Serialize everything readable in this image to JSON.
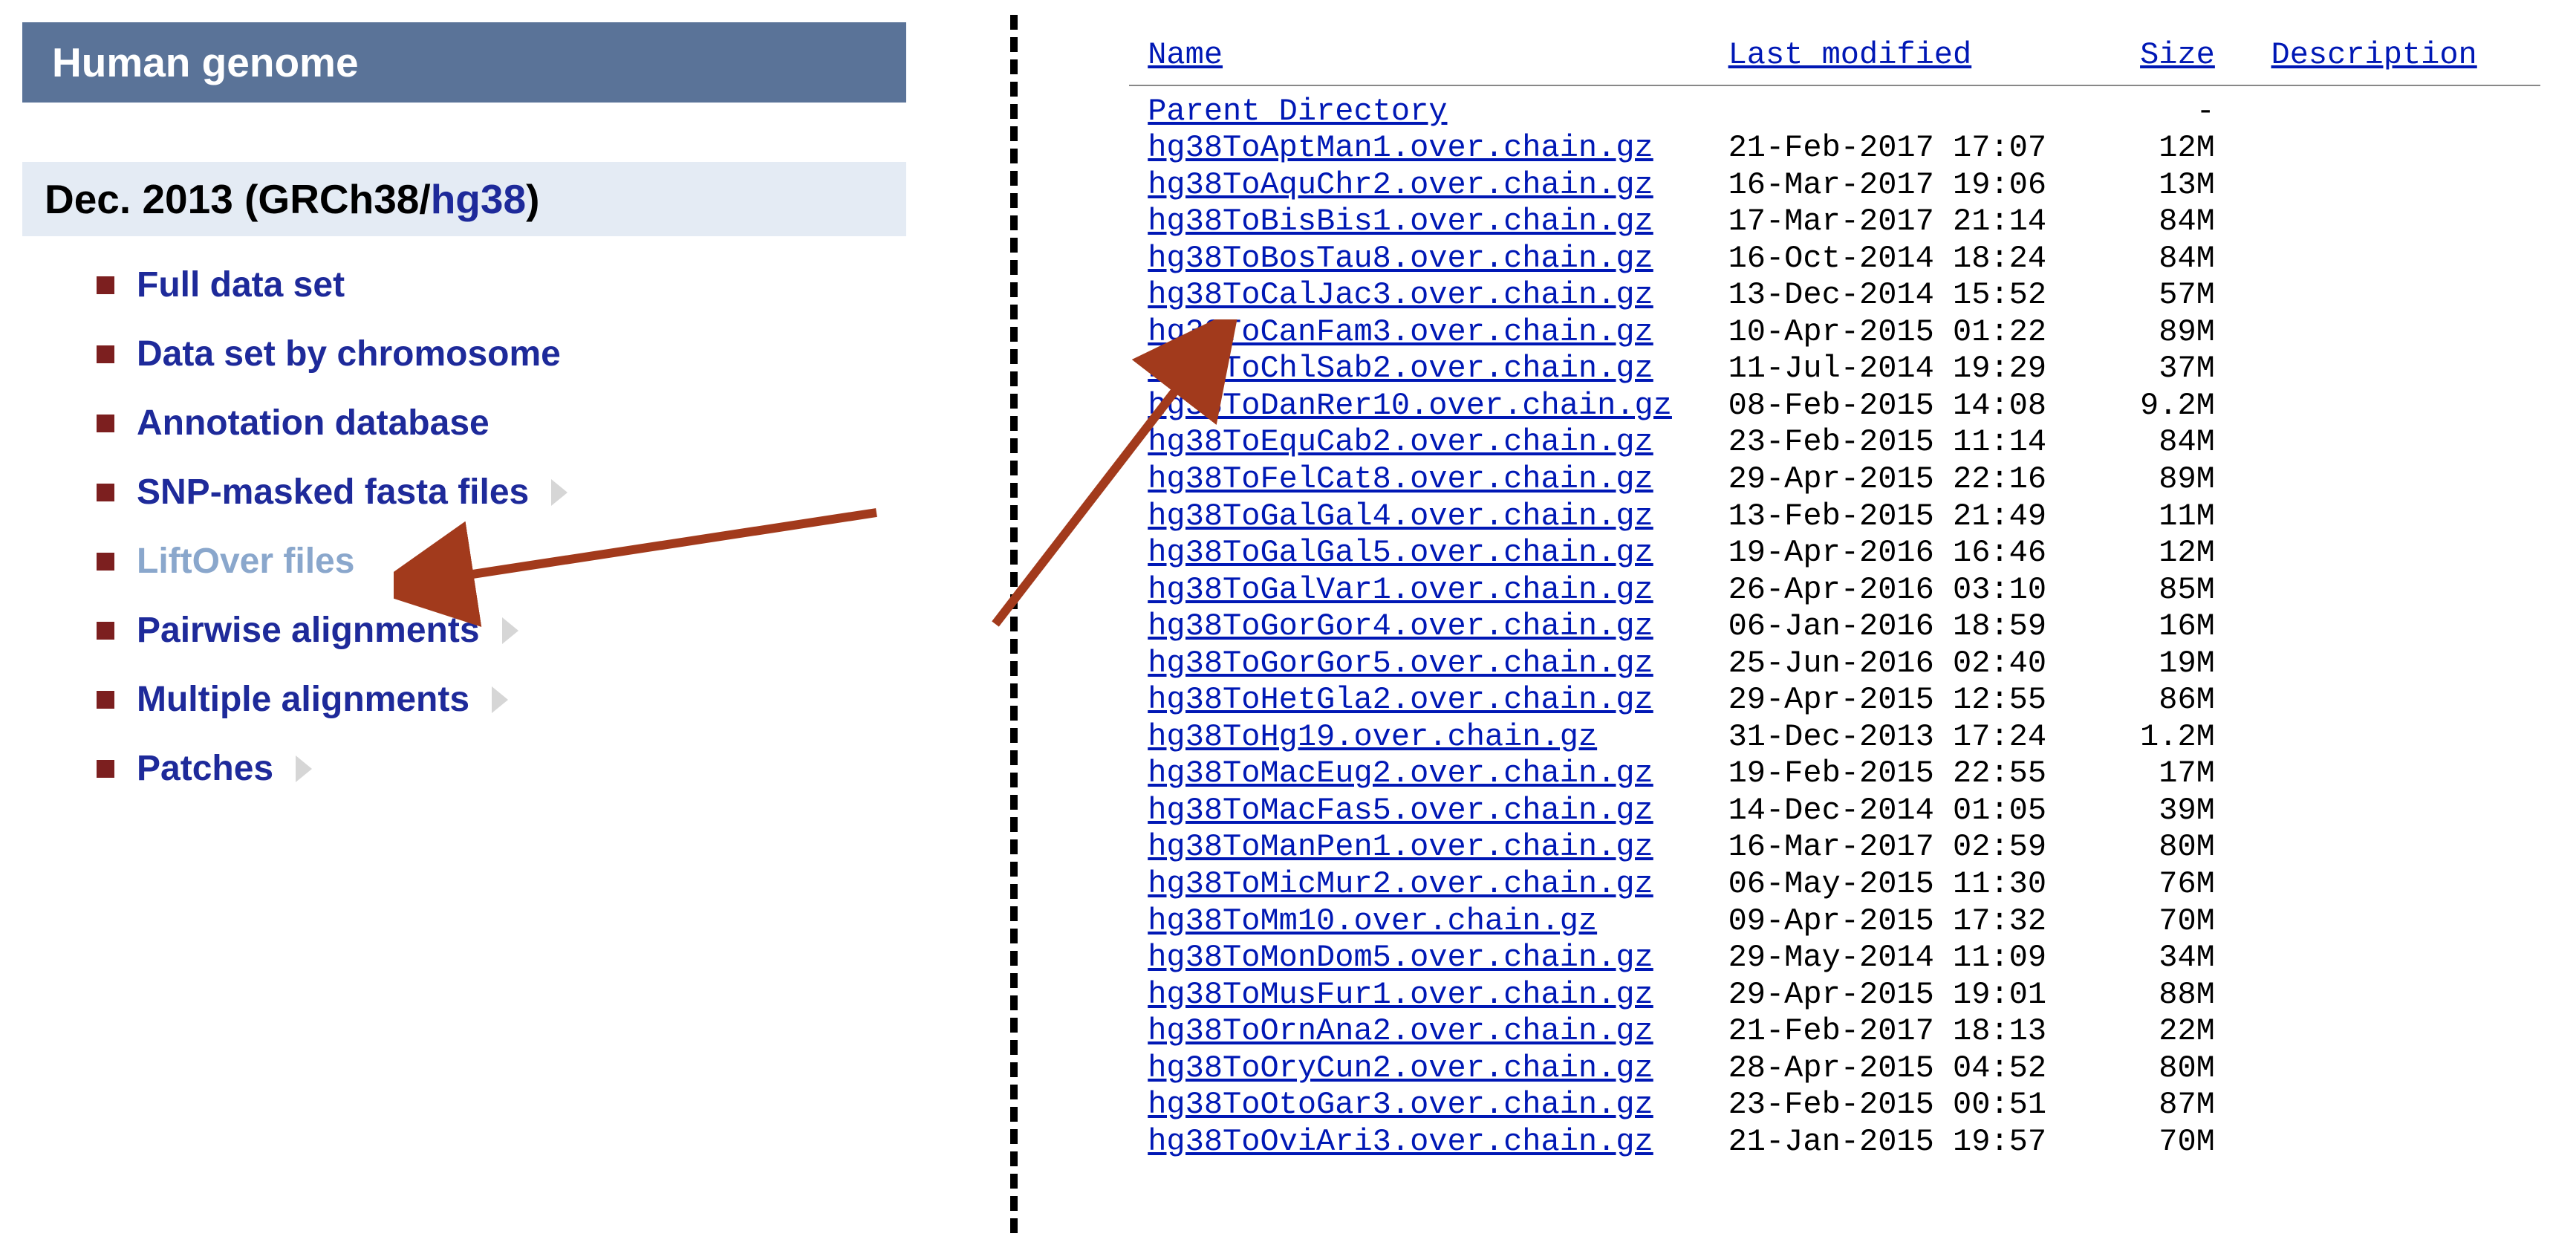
{
  "sidebar": {
    "header": "Human genome",
    "subheader_prefix": "Dec. 2013 (GRCh38/",
    "subheader_link": "hg38",
    "subheader_suffix": ")",
    "items": [
      {
        "label": "Full data set",
        "chevron": false,
        "active": false
      },
      {
        "label": "Data set by chromosome",
        "chevron": false,
        "active": false
      },
      {
        "label": "Annotation database",
        "chevron": false,
        "active": false
      },
      {
        "label": "SNP-masked fasta files",
        "chevron": true,
        "active": false
      },
      {
        "label": "LiftOver files",
        "chevron": false,
        "active": true
      },
      {
        "label": "Pairwise alignments",
        "chevron": true,
        "active": false
      },
      {
        "label": "Multiple alignments",
        "chevron": true,
        "active": false
      },
      {
        "label": "Patches",
        "chevron": true,
        "active": false
      }
    ]
  },
  "listing": {
    "cols": {
      "name": "Name",
      "modified": "Last modified",
      "size": "Size",
      "desc": "Description"
    },
    "parent": "Parent Directory",
    "rows": [
      {
        "name": "hg38ToAptMan1.over.chain.gz",
        "modified": "21-Feb-2017 17:07",
        "size": "12M"
      },
      {
        "name": "hg38ToAquChr2.over.chain.gz",
        "modified": "16-Mar-2017 19:06",
        "size": "13M"
      },
      {
        "name": "hg38ToBisBis1.over.chain.gz",
        "modified": "17-Mar-2017 21:14",
        "size": "84M"
      },
      {
        "name": "hg38ToBosTau8.over.chain.gz",
        "modified": "16-Oct-2014 18:24",
        "size": "84M"
      },
      {
        "name": "hg38ToCalJac3.over.chain.gz",
        "modified": "13-Dec-2014 15:52",
        "size": "57M"
      },
      {
        "name": "hg38ToCanFam3.over.chain.gz",
        "modified": "10-Apr-2015 01:22",
        "size": "89M"
      },
      {
        "name": "hg38ToChlSab2.over.chain.gz",
        "modified": "11-Jul-2014 19:29",
        "size": "37M"
      },
      {
        "name": "hg38ToDanRer10.over.chain.gz",
        "modified": "08-Feb-2015 14:08",
        "size": "9.2M"
      },
      {
        "name": "hg38ToEquCab2.over.chain.gz",
        "modified": "23-Feb-2015 11:14",
        "size": "84M"
      },
      {
        "name": "hg38ToFelCat8.over.chain.gz",
        "modified": "29-Apr-2015 22:16",
        "size": "89M"
      },
      {
        "name": "hg38ToGalGal4.over.chain.gz",
        "modified": "13-Feb-2015 21:49",
        "size": "11M"
      },
      {
        "name": "hg38ToGalGal5.over.chain.gz",
        "modified": "19-Apr-2016 16:46",
        "size": "12M"
      },
      {
        "name": "hg38ToGalVar1.over.chain.gz",
        "modified": "26-Apr-2016 03:10",
        "size": "85M"
      },
      {
        "name": "hg38ToGorGor4.over.chain.gz",
        "modified": "06-Jan-2016 18:59",
        "size": "16M"
      },
      {
        "name": "hg38ToGorGor5.over.chain.gz",
        "modified": "25-Jun-2016 02:40",
        "size": "19M"
      },
      {
        "name": "hg38ToHetGla2.over.chain.gz",
        "modified": "29-Apr-2015 12:55",
        "size": "86M"
      },
      {
        "name": "hg38ToHg19.over.chain.gz",
        "modified": "31-Dec-2013 17:24",
        "size": "1.2M"
      },
      {
        "name": "hg38ToMacEug2.over.chain.gz",
        "modified": "19-Feb-2015 22:55",
        "size": "17M"
      },
      {
        "name": "hg38ToMacFas5.over.chain.gz",
        "modified": "14-Dec-2014 01:05",
        "size": "39M"
      },
      {
        "name": "hg38ToManPen1.over.chain.gz",
        "modified": "16-Mar-2017 02:59",
        "size": "80M"
      },
      {
        "name": "hg38ToMicMur2.over.chain.gz",
        "modified": "06-May-2015 11:30",
        "size": "76M"
      },
      {
        "name": "hg38ToMm10.over.chain.gz",
        "modified": "09-Apr-2015 17:32",
        "size": "70M"
      },
      {
        "name": "hg38ToMonDom5.over.chain.gz",
        "modified": "29-May-2014 11:09",
        "size": "34M"
      },
      {
        "name": "hg38ToMusFur1.over.chain.gz",
        "modified": "29-Apr-2015 19:01",
        "size": "88M"
      },
      {
        "name": "hg38ToOrnAna2.over.chain.gz",
        "modified": "21-Feb-2017 18:13",
        "size": "22M"
      },
      {
        "name": "hg38ToOryCun2.over.chain.gz",
        "modified": "28-Apr-2015 04:52",
        "size": "80M"
      },
      {
        "name": "hg38ToOtoGar3.over.chain.gz",
        "modified": "23-Feb-2015 00:51",
        "size": "87M"
      },
      {
        "name": "hg38ToOviAri3.over.chain.gz",
        "modified": "21-Jan-2015 19:57",
        "size": "70M"
      }
    ]
  }
}
